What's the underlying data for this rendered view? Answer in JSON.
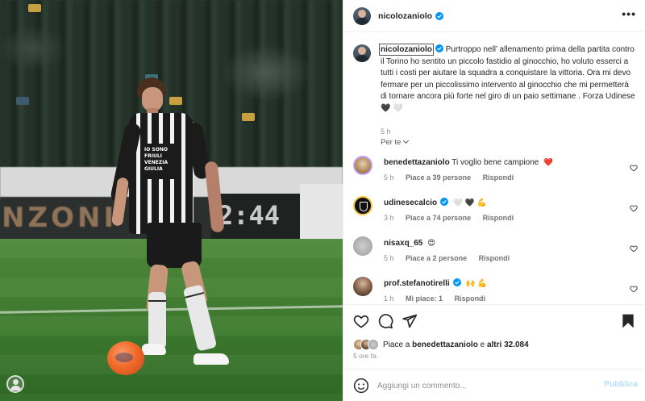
{
  "post": {
    "username": "nicolozaniolo",
    "caption_user": "nicolozaniolo",
    "caption_text": " Purtroppo nell’ allenamento prima della partita contro il Torino ho sentito un piccolo fastidio al ginocchio, ho voluto esserci a tutti i costi per aiutare la squadra a conquistare la vittoria. Ora mi devo fermare per un piccolissimo intervento al ginocchio che mi permetterà di tornare ancora più forte nel giro di un paio settimane . Forza Udinese 🖤 🤍",
    "caption_time": "5 h",
    "sort_label": "Per te",
    "photo_board_text": "NZONI",
    "photo_clock_text": "2:44",
    "jersey_text": "IO SONO FRIULI VENEZIA GIULIA"
  },
  "comments": [
    {
      "user": "benedettazaniolo",
      "text": "Ti voglio bene campione",
      "emoji": "❤️",
      "time": "5 h",
      "likes": "Piace a 39 persone",
      "reply": "Rispondi"
    },
    {
      "user": "udinesecalcio",
      "text": "",
      "emoji": "🤍 🖤 💪",
      "time": "3 h",
      "likes": "Piace a 74 persone",
      "reply": "Rispondi"
    },
    {
      "user": "nisaxq_65",
      "text": "",
      "emoji": "😍",
      "time": "5 h",
      "likes": "Piace a 2 persone",
      "reply": "Rispondi"
    },
    {
      "user": "prof.stefanotirelli",
      "text": "",
      "emoji": "🙌 💪",
      "time": "1 h",
      "likes": "Mi piace: 1",
      "reply": "Rispondi"
    }
  ],
  "likes": {
    "prefix": "Piace a ",
    "first": "benedettazaniolo",
    "middle": " e ",
    "rest": "altri 32.084"
  },
  "time_ago": "5 ore fa",
  "comment_box": {
    "placeholder": "Aggiungi un commento...",
    "publish": "Pubblica"
  },
  "colors": {
    "verified": "#0095f6",
    "heart_red": "#ed4956",
    "publish_disabled": "#b2dffc"
  },
  "icons": [
    "verified-badge-icon",
    "more-options-icon",
    "heart-icon",
    "comment-icon",
    "share-icon",
    "bookmark-icon",
    "emoji-icon",
    "chevron-down-icon",
    "user-icon"
  ]
}
